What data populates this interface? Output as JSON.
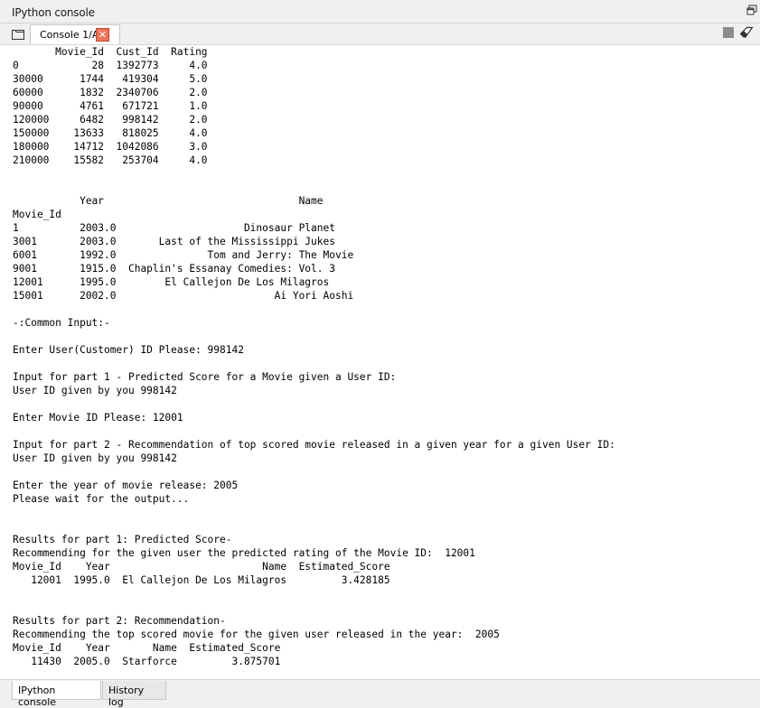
{
  "window": {
    "title": "IPython console"
  },
  "tabs": {
    "console_tab_label": "Console 1/A"
  },
  "console": {
    "lines": [
      "       Movie_Id  Cust_Id  Rating",
      "0            28  1392773     4.0",
      "30000      1744   419304     5.0",
      "60000      1832  2340706     2.0",
      "90000      4761   671721     1.0",
      "120000     6482   998142     2.0",
      "150000    13633   818025     4.0",
      "180000    14712  1042086     3.0",
      "210000    15582   253704     4.0",
      "",
      "",
      "           Year                                Name",
      "Movie_Id",
      "1          2003.0                     Dinosaur Planet",
      "3001       2003.0       Last of the Mississippi Jukes",
      "6001       1992.0               Tom and Jerry: The Movie",
      "9001       1915.0  Chaplin's Essanay Comedies: Vol. 3",
      "12001      1995.0        El Callejon De Los Milagros",
      "15001      2002.0                          Ai Yori Aoshi",
      "",
      "-:Common Input:-",
      "",
      "Enter User(Customer) ID Please: 998142",
      "",
      "Input for part 1 - Predicted Score for a Movie given a User ID:",
      "User ID given by you 998142",
      "",
      "Enter Movie ID Please: 12001",
      "",
      "Input for part 2 - Recommendation of top scored movie released in a given year for a given User ID:",
      "User ID given by you 998142",
      "",
      "Enter the year of movie release: 2005",
      "Please wait for the output...",
      "",
      "",
      "Results for part 1: Predicted Score-",
      "Recommending for the given user the predicted rating of the Movie ID:  12001",
      "Movie_Id    Year                         Name  Estimated_Score",
      "   12001  1995.0  El Callejon De Los Milagros         3.428185",
      "",
      "",
      "Results for part 2: Recommendation-",
      "Recommending the top scored movie for the given user released in the year:  2005",
      "Movie_Id    Year       Name  Estimated_Score",
      "   11430  2005.0  Starforce         3.875701"
    ]
  },
  "bottom_tabs": {
    "ipython_console": "IPython console",
    "history_log": "History log"
  },
  "colors": {
    "close_button": "#e9765a",
    "console_background": "#ffffff",
    "chrome_background": "#f0f0f0"
  },
  "icons": {
    "browse_tabs": "browse-tabs-icon",
    "close_tab": "close-icon",
    "stop": "stop-icon",
    "clear": "eraser-icon",
    "undock": "undock-icon"
  }
}
